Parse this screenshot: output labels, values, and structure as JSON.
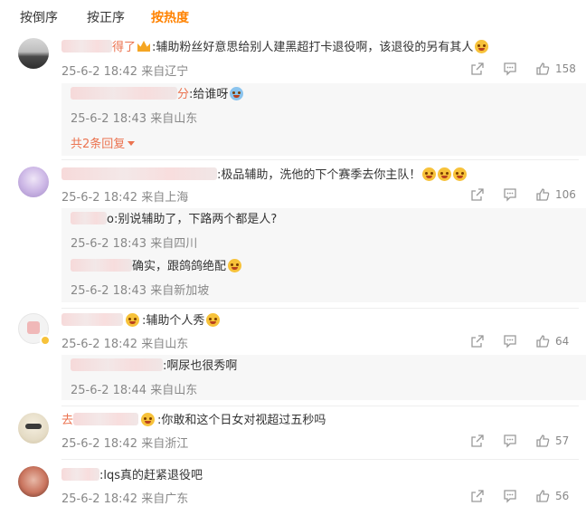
{
  "sort": {
    "reverse": "按倒序",
    "normal": "按正序",
    "hot": "按热度"
  },
  "comments": [
    {
      "name_suffix": "得了",
      "text": ":辅助粉丝好意思给别人建黑超打卡退役啊，该退役的另有其人",
      "time": "25-6-2 18:42",
      "loc": "来自辽宁",
      "likes": "158",
      "replies": [
        {
          "text": ":给谁呀",
          "time": "25-6-2 18:43",
          "loc": "来自山东"
        }
      ],
      "expand": "共2条回复"
    },
    {
      "name_suffix": "",
      "text": ":极品辅助，洗他的下个赛季去你主队！",
      "time": "25-6-2 18:42",
      "loc": "来自上海",
      "likes": "106",
      "replies": [
        {
          "text": "o:别说辅助了，下路两个都是人?",
          "time": "25-6-2 18:43",
          "loc": "来自四川"
        },
        {
          "text": "确实，跟鸽鸽绝配",
          "time": "25-6-2 18:43",
          "loc": "来自新加坡"
        }
      ]
    },
    {
      "name_suffix": "",
      "text": ":辅助个人秀",
      "time": "25-6-2 18:42",
      "loc": "来自山东",
      "likes": "64",
      "replies": [
        {
          "text": ":啊尿也很秀啊",
          "time": "25-6-2 18:44",
          "loc": "来自山东"
        }
      ]
    },
    {
      "name_prefix": "去",
      "text": ":你敢和这个日女对视超过五秒吗",
      "time": "25-6-2 18:42",
      "loc": "来自浙江",
      "likes": "57"
    },
    {
      "name_suffix": "",
      "text": ":lqs真的赶紧退役吧",
      "time": "25-6-2 18:42",
      "loc": "来自广东",
      "likes": "56"
    }
  ],
  "colors": {
    "accent": "#ff8200",
    "reply_link": "#eb7350",
    "meta": "#888888"
  }
}
